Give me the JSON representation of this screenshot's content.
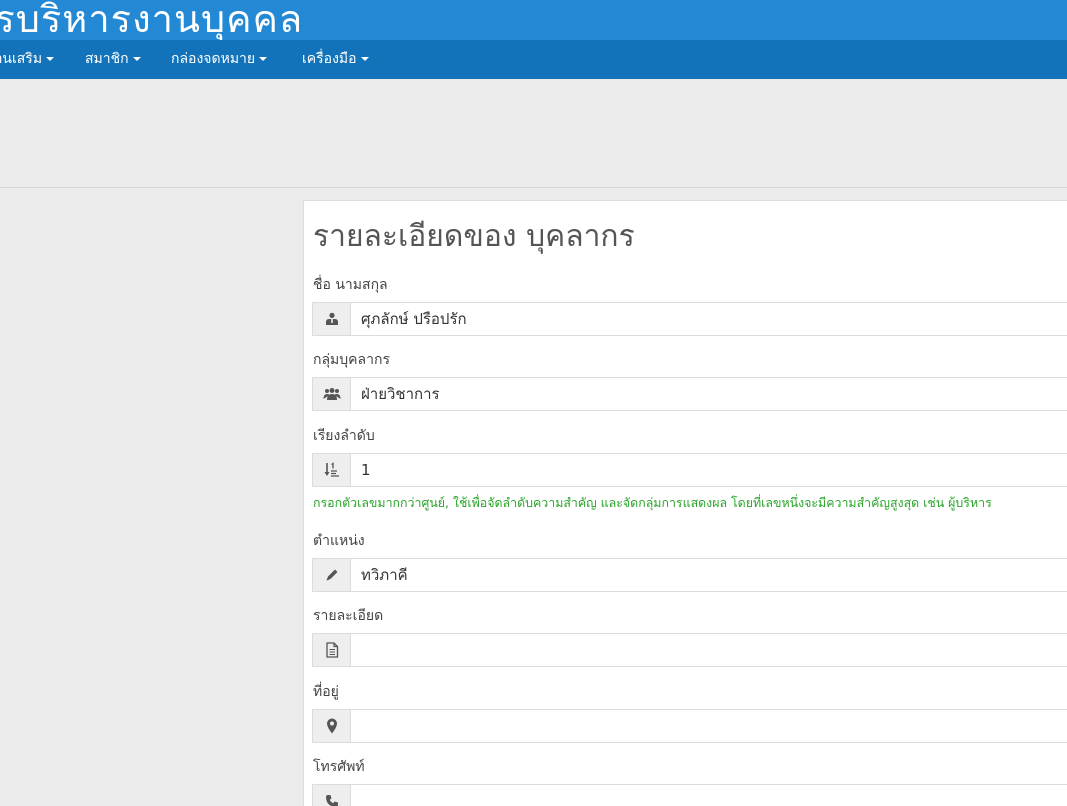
{
  "header": {
    "site_title": "ารบริหารงานบุคคล"
  },
  "nav": {
    "items": [
      {
        "label": "อนเสริม"
      },
      {
        "label": "สมาชิก"
      },
      {
        "label": "กล่องจดหมาย"
      },
      {
        "label": "เครื่องมือ"
      }
    ]
  },
  "panel": {
    "title": "รายละเอียดของ บุคลากร",
    "fields": {
      "name": {
        "label": "ชื่อ นามสกุล",
        "value": "ศุภลักษ์ ปรือปรัก",
        "icon": "user-icon"
      },
      "group": {
        "label": "กลุ่มบุคลากร",
        "value": "ฝ่ายวิชาการ",
        "icon": "users-icon"
      },
      "order": {
        "label": "เรียงลำดับ",
        "value": "1",
        "icon": "sort-numeric-icon",
        "help": "กรอกตัวเลขมากกว่าศูนย์, ใช้เพื่อจัดลำดับความสำคัญ และจัดกลุ่มการแสดงผล โดยที่เลขหนึ่งจะมีความสำคัญสูงสุด เช่น ผู้บริหาร"
      },
      "position": {
        "label": "ตำแหน่ง",
        "value": "ทวิภาคี",
        "icon": "pencil-icon"
      },
      "details": {
        "label": "รายละเอียด",
        "value": "",
        "icon": "document-icon"
      },
      "address": {
        "label": "ที่อยู่",
        "value": "",
        "icon": "map-marker-icon"
      },
      "phone": {
        "label": "โทรศัพท์",
        "value": "",
        "icon": "phone-icon"
      }
    }
  }
}
